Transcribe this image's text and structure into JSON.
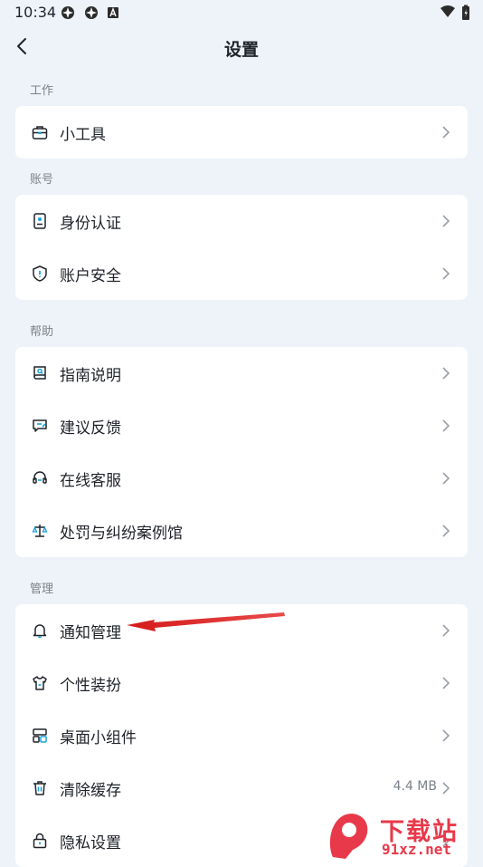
{
  "status_bar": {
    "time": "10:34"
  },
  "header": {
    "title": "设置"
  },
  "sections": [
    {
      "label": "工作",
      "items": [
        {
          "label": "小工具",
          "icon": "toolbox-icon"
        }
      ]
    },
    {
      "label": "账号",
      "items": [
        {
          "label": "身份认证",
          "icon": "id-card-icon"
        },
        {
          "label": "账户安全",
          "icon": "shield-icon"
        }
      ]
    },
    {
      "label": "帮助",
      "items": [
        {
          "label": "指南说明",
          "icon": "guide-book-icon"
        },
        {
          "label": "建议反馈",
          "icon": "feedback-icon"
        },
        {
          "label": "在线客服",
          "icon": "headset-icon"
        },
        {
          "label": "处罚与纠纷案例馆",
          "icon": "scales-icon"
        }
      ]
    },
    {
      "label": "管理",
      "items": [
        {
          "label": "通知管理",
          "icon": "bell-icon"
        },
        {
          "label": "个性装扮",
          "icon": "tshirt-icon"
        },
        {
          "label": "桌面小组件",
          "icon": "widgets-icon"
        },
        {
          "label": "清除缓存",
          "icon": "trash-icon",
          "value": "4.4 MB"
        },
        {
          "label": "隐私设置",
          "icon": "lock-icon"
        }
      ]
    }
  ],
  "watermark": {
    "logo_text": "9",
    "brand_text": "下载站",
    "url_text": "91xz.net"
  },
  "colors": {
    "background": "#eef3f9",
    "card": "#ffffff",
    "annotation_arrow": "#e02020",
    "watermark": "#e8394b"
  }
}
